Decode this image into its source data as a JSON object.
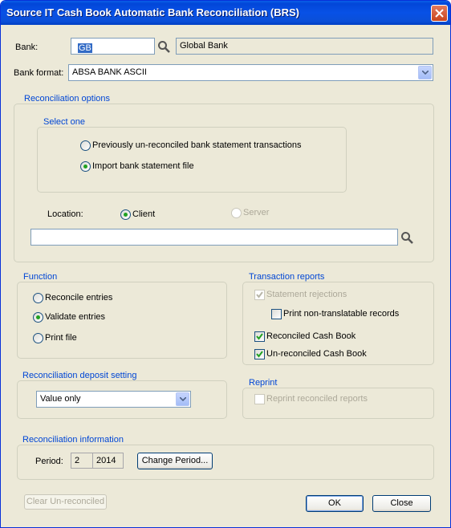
{
  "window": {
    "title": "Source IT Cash Book Automatic Bank Reconciliation (BRS)"
  },
  "bank": {
    "label": "Bank:",
    "code": "GB",
    "name": "Global Bank"
  },
  "bank_format": {
    "label": "Bank format:",
    "value": "ABSA BANK ASCII"
  },
  "recon_options": {
    "title": "Reconciliation options",
    "select_one": "Select one",
    "opt1": "Previously un-reconciled bank statement transactions",
    "opt2": "Import bank statement file",
    "selected": "opt2",
    "location_label": "Location:",
    "client": "Client",
    "server": "Server",
    "path": ""
  },
  "function": {
    "title": "Function",
    "reconcile": "Reconcile entries",
    "validate": "Validate entries",
    "print": "Print file",
    "selected": "validate"
  },
  "transaction_reports": {
    "title": "Transaction reports",
    "statement_rejections": "Statement rejections",
    "print_nontranslatable": "Print non-translatable records",
    "reconciled": "Reconciled Cash Book",
    "unreconciled": "Un-reconciled Cash Book"
  },
  "deposit": {
    "title": "Reconciliation deposit setting",
    "value": "Value only"
  },
  "reprint": {
    "title": "Reprint",
    "label": "Reprint reconciled reports"
  },
  "info": {
    "title": "Reconciliation information",
    "period_label": "Period:",
    "period": "2",
    "year": "2014",
    "change_button": "Change Period..."
  },
  "buttons": {
    "clear": "Clear Un-reconciled",
    "ok": "OK",
    "close": "Close"
  },
  "colors": {
    "title_bar": "#0a4fd8",
    "group_title": "#0046d5",
    "dialog_bg": "#ece9d8",
    "radio_dot": "#21a121"
  }
}
